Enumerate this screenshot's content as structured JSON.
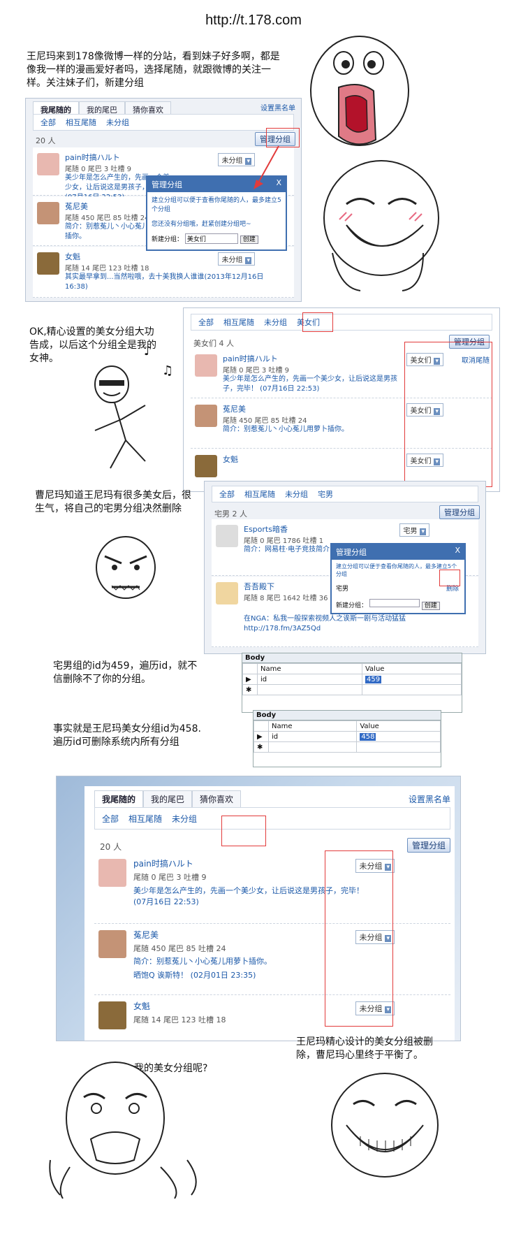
{
  "header": {
    "url": "http://t.178.com"
  },
  "captions": {
    "intro": "王尼玛来到178像微博一样的分站，看到妹子好多啊，都是像我一样的漫画爱好者吗，选择尾随，就跟微博的关注一样。关注妹子们，新建分组",
    "ok": "OK,精心设置的美女分组大功告成，以后这个分组全是我的女神。",
    "angry": "曹尼玛知道王尼玛有很多美女后，很生气，将自己的宅男分组决然删除",
    "id459": "宅男组的id为459，遍历id，就不信删除不了你的分组。",
    "id458": "事实就是王尼玛美女分组id为458. 遍历id可删除系统内所有分组",
    "ending": "王尼玛精心设计的美女分组被删除，曹尼玛心里终于平衡了。",
    "where": "我的美女分组呢?"
  },
  "ui": {
    "tabs": [
      "我尾随的",
      "我的尾巴",
      "猜你喜欢"
    ],
    "blacklist": "设置黑名单",
    "filters_all": "全部",
    "filters_mutual": "相互尾随",
    "filters_ungrouped": "未分组",
    "filters_beauty": "美女们",
    "filters_otaku": "宅男",
    "count_20": "20 人",
    "count_4": "美女们 4 人",
    "count_2": "宅男 2 人",
    "manage_btn": "管理分组",
    "cancel_follow": "取消尾随",
    "ungrouped_sel": "未分组",
    "beauty_sel": "美女们",
    "otaku_sel": "宅男",
    "users": [
      {
        "name": "pain时搞ハルト",
        "stats": "尾随 0 尾巴 3 吐槽 9",
        "text": "美少年是怎么产生的，先画一个美少女，让后说这是男孩子，完毕！ (07月16日 22:53)"
      },
      {
        "name": "菟尼美",
        "stats": "尾随 450 尾巴 85 吐槽 24",
        "text": "简介：别惹菟儿丶小心菟儿用萝卜插你。",
        "extra": "晒饱Q 诶斯特！ (02月01日 23:35)"
      },
      {
        "name": "女魁",
        "stats": "尾随 14 尾巴 123 吐槽 18",
        "text": "其实最早拿到...当然啦哦，去十美我换人谁谁(2013年12月16日 16:38)"
      }
    ],
    "otaku_users": [
      {
        "name": "Esports暗香",
        "stats": "尾随 0 尾巴 1786 吐槽 1",
        "text": "简介：网易柱·电子竞技简介·想在..."
      },
      {
        "name": "吾吾殿下",
        "stats": "尾随 8 尾巴 1642 吐槽 36",
        "text": "在NGA：私我一般探索视频人之诶斯一剧与活动猛猛http://178.fm/3AZ5Qd"
      }
    ],
    "dialog": {
      "title": "管理分组",
      "close": "X",
      "desc": "建立分组可以便于查看你尾随的人，最多建立5个分组",
      "empty": "您还没有分组哦，赶紧创建分组吧~",
      "new_label": "新建分组：",
      "new_value": "美女们",
      "create_btn": "创建",
      "otaku_item": "宅男",
      "delete_btn": "删除"
    },
    "grid": {
      "title": "Body",
      "col_name": "Name",
      "col_value": "Value",
      "row_name": "id",
      "value_459": "459",
      "value_458": "458"
    }
  },
  "colors": {
    "accent": "#3f6fb0",
    "link": "#1b58a8",
    "highlight": "#e23b3b"
  }
}
